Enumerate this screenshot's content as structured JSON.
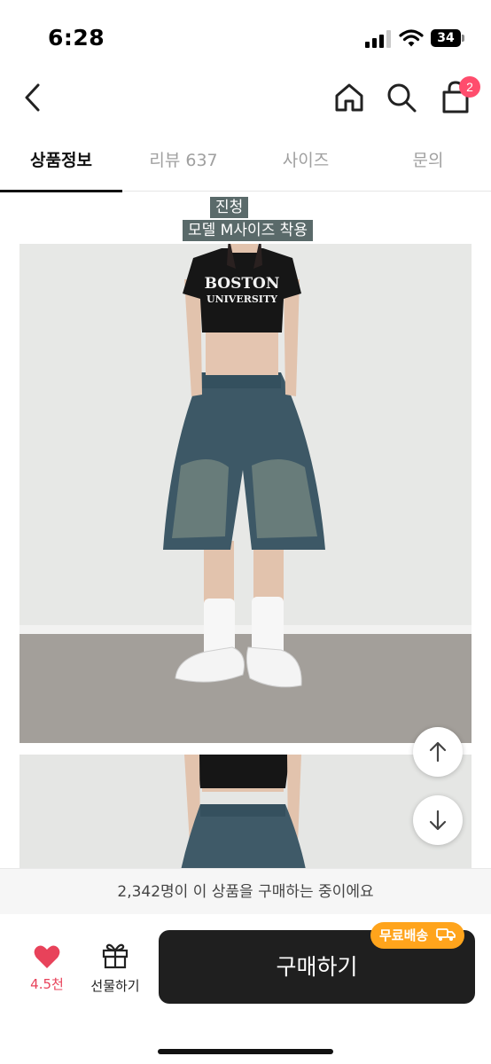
{
  "status_bar": {
    "time": "6:28",
    "battery": "34"
  },
  "header": {
    "cart_count": "2"
  },
  "tabs": [
    {
      "label": "상품정보",
      "active": true
    },
    {
      "label": "리뷰 637",
      "active": false
    },
    {
      "label": "사이즈",
      "active": false
    },
    {
      "label": "문의",
      "active": false
    }
  ],
  "product_detail": {
    "color_label": "진청",
    "size_label": "모델 M사이즈 착용",
    "shirt_text_line1": "BOSTON",
    "shirt_text_line2": "UNIVERSITY"
  },
  "notice": {
    "buyers_text": "2,342명이 이 상품을 구매하는 중이에요"
  },
  "bottom_bar": {
    "like_count": "4.5천",
    "gift_label": "선물하기",
    "buy_label": "구매하기",
    "free_shipping_label": "무료배송"
  },
  "colors": {
    "accent": "#ff4d6d",
    "like": "#e8425a",
    "buy_button": "#1f1f1f",
    "shipping_badge": "#ffa41c"
  }
}
